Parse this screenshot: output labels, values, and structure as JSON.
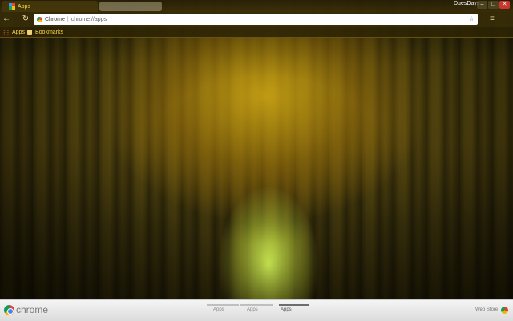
{
  "tab": {
    "title": "Apps"
  },
  "window": {
    "profile_name": "DuesDays"
  },
  "omnibox": {
    "site_label": "Chrome",
    "url": "chrome://apps"
  },
  "bookmarks": [
    {
      "label": "Apps",
      "icon": "apps-grid-icon"
    },
    {
      "label": "Bookmarks",
      "icon": "folder-icon"
    }
  ],
  "bottom": {
    "brand": "chrome",
    "page_tabs": [
      "Apps",
      "Apps",
      "Apps"
    ],
    "webstore_label": "Web Store"
  }
}
